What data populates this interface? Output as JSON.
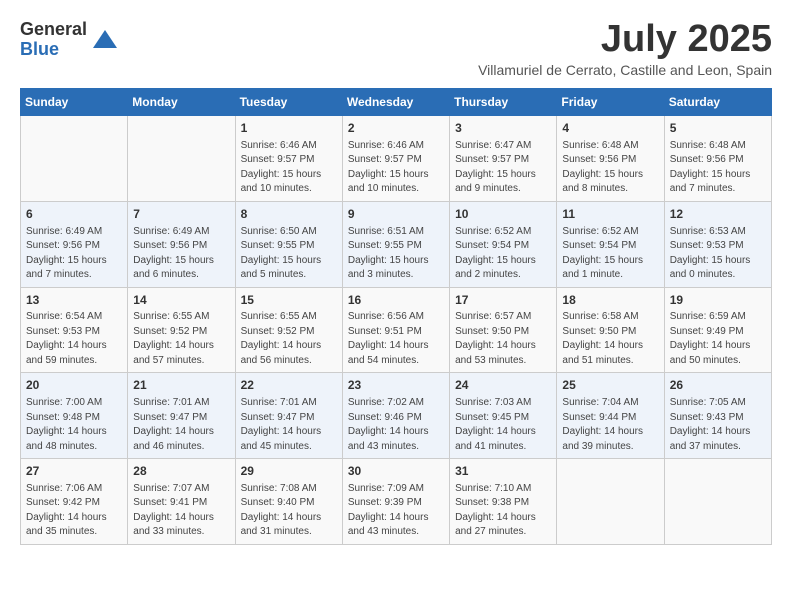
{
  "logo": {
    "general": "General",
    "blue": "Blue"
  },
  "title": "July 2025",
  "subtitle": "Villamuriel de Cerrato, Castille and Leon, Spain",
  "weekdays": [
    "Sunday",
    "Monday",
    "Tuesday",
    "Wednesday",
    "Thursday",
    "Friday",
    "Saturday"
  ],
  "weeks": [
    [
      {
        "day": "",
        "info": ""
      },
      {
        "day": "",
        "info": ""
      },
      {
        "day": "1",
        "info": "Sunrise: 6:46 AM\nSunset: 9:57 PM\nDaylight: 15 hours and 10 minutes."
      },
      {
        "day": "2",
        "info": "Sunrise: 6:46 AM\nSunset: 9:57 PM\nDaylight: 15 hours and 10 minutes."
      },
      {
        "day": "3",
        "info": "Sunrise: 6:47 AM\nSunset: 9:57 PM\nDaylight: 15 hours and 9 minutes."
      },
      {
        "day": "4",
        "info": "Sunrise: 6:48 AM\nSunset: 9:56 PM\nDaylight: 15 hours and 8 minutes."
      },
      {
        "day": "5",
        "info": "Sunrise: 6:48 AM\nSunset: 9:56 PM\nDaylight: 15 hours and 7 minutes."
      }
    ],
    [
      {
        "day": "6",
        "info": "Sunrise: 6:49 AM\nSunset: 9:56 PM\nDaylight: 15 hours and 7 minutes."
      },
      {
        "day": "7",
        "info": "Sunrise: 6:49 AM\nSunset: 9:56 PM\nDaylight: 15 hours and 6 minutes."
      },
      {
        "day": "8",
        "info": "Sunrise: 6:50 AM\nSunset: 9:55 PM\nDaylight: 15 hours and 5 minutes."
      },
      {
        "day": "9",
        "info": "Sunrise: 6:51 AM\nSunset: 9:55 PM\nDaylight: 15 hours and 3 minutes."
      },
      {
        "day": "10",
        "info": "Sunrise: 6:52 AM\nSunset: 9:54 PM\nDaylight: 15 hours and 2 minutes."
      },
      {
        "day": "11",
        "info": "Sunrise: 6:52 AM\nSunset: 9:54 PM\nDaylight: 15 hours and 1 minute."
      },
      {
        "day": "12",
        "info": "Sunrise: 6:53 AM\nSunset: 9:53 PM\nDaylight: 15 hours and 0 minutes."
      }
    ],
    [
      {
        "day": "13",
        "info": "Sunrise: 6:54 AM\nSunset: 9:53 PM\nDaylight: 14 hours and 59 minutes."
      },
      {
        "day": "14",
        "info": "Sunrise: 6:55 AM\nSunset: 9:52 PM\nDaylight: 14 hours and 57 minutes."
      },
      {
        "day": "15",
        "info": "Sunrise: 6:55 AM\nSunset: 9:52 PM\nDaylight: 14 hours and 56 minutes."
      },
      {
        "day": "16",
        "info": "Sunrise: 6:56 AM\nSunset: 9:51 PM\nDaylight: 14 hours and 54 minutes."
      },
      {
        "day": "17",
        "info": "Sunrise: 6:57 AM\nSunset: 9:50 PM\nDaylight: 14 hours and 53 minutes."
      },
      {
        "day": "18",
        "info": "Sunrise: 6:58 AM\nSunset: 9:50 PM\nDaylight: 14 hours and 51 minutes."
      },
      {
        "day": "19",
        "info": "Sunrise: 6:59 AM\nSunset: 9:49 PM\nDaylight: 14 hours and 50 minutes."
      }
    ],
    [
      {
        "day": "20",
        "info": "Sunrise: 7:00 AM\nSunset: 9:48 PM\nDaylight: 14 hours and 48 minutes."
      },
      {
        "day": "21",
        "info": "Sunrise: 7:01 AM\nSunset: 9:47 PM\nDaylight: 14 hours and 46 minutes."
      },
      {
        "day": "22",
        "info": "Sunrise: 7:01 AM\nSunset: 9:47 PM\nDaylight: 14 hours and 45 minutes."
      },
      {
        "day": "23",
        "info": "Sunrise: 7:02 AM\nSunset: 9:46 PM\nDaylight: 14 hours and 43 minutes."
      },
      {
        "day": "24",
        "info": "Sunrise: 7:03 AM\nSunset: 9:45 PM\nDaylight: 14 hours and 41 minutes."
      },
      {
        "day": "25",
        "info": "Sunrise: 7:04 AM\nSunset: 9:44 PM\nDaylight: 14 hours and 39 minutes."
      },
      {
        "day": "26",
        "info": "Sunrise: 7:05 AM\nSunset: 9:43 PM\nDaylight: 14 hours and 37 minutes."
      }
    ],
    [
      {
        "day": "27",
        "info": "Sunrise: 7:06 AM\nSunset: 9:42 PM\nDaylight: 14 hours and 35 minutes."
      },
      {
        "day": "28",
        "info": "Sunrise: 7:07 AM\nSunset: 9:41 PM\nDaylight: 14 hours and 33 minutes."
      },
      {
        "day": "29",
        "info": "Sunrise: 7:08 AM\nSunset: 9:40 PM\nDaylight: 14 hours and 31 minutes."
      },
      {
        "day": "30",
        "info": "Sunrise: 7:09 AM\nSunset: 9:39 PM\nDaylight: 14 hours and 43 minutes."
      },
      {
        "day": "31",
        "info": "Sunrise: 7:10 AM\nSunset: 9:38 PM\nDaylight: 14 hours and 27 minutes."
      },
      {
        "day": "",
        "info": ""
      },
      {
        "day": "",
        "info": ""
      }
    ]
  ]
}
